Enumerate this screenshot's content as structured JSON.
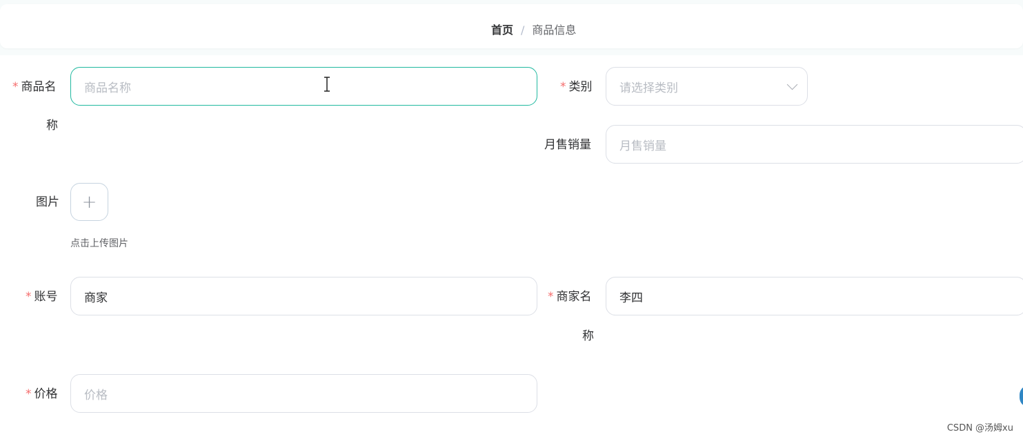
{
  "breadcrumb": {
    "home": "首页",
    "separator": "/",
    "current": "商品信息"
  },
  "form": {
    "name": {
      "label_line1": "商品名",
      "label_line2": "称",
      "required_mark": "*",
      "placeholder": "商品名称"
    },
    "category": {
      "label": "类别",
      "required_mark": "*",
      "placeholder": "请选择类别"
    },
    "monthly_sales": {
      "label": "月售销量",
      "placeholder": "月售销量"
    },
    "image": {
      "label": "图片",
      "upload_symbol": "+",
      "tip": "点击上传图片"
    },
    "account": {
      "label": "账号",
      "required_mark": "*",
      "value": "商家"
    },
    "merchant_name": {
      "label_line1": "商家名",
      "label_line2": "称",
      "required_mark": "*",
      "value": "李四"
    },
    "price": {
      "label": "价格",
      "required_mark": "*",
      "placeholder": "价格"
    }
  },
  "watermark": "CSDN @汤姆xu",
  "colors": {
    "focus_border": "#1fb89f",
    "required": "#f56c6c",
    "placeholder": "#b8bcc3"
  },
  "icons": {
    "cursor": "text-cursor-icon",
    "dropdown": "chevron-down-icon",
    "upload": "plus-icon"
  }
}
